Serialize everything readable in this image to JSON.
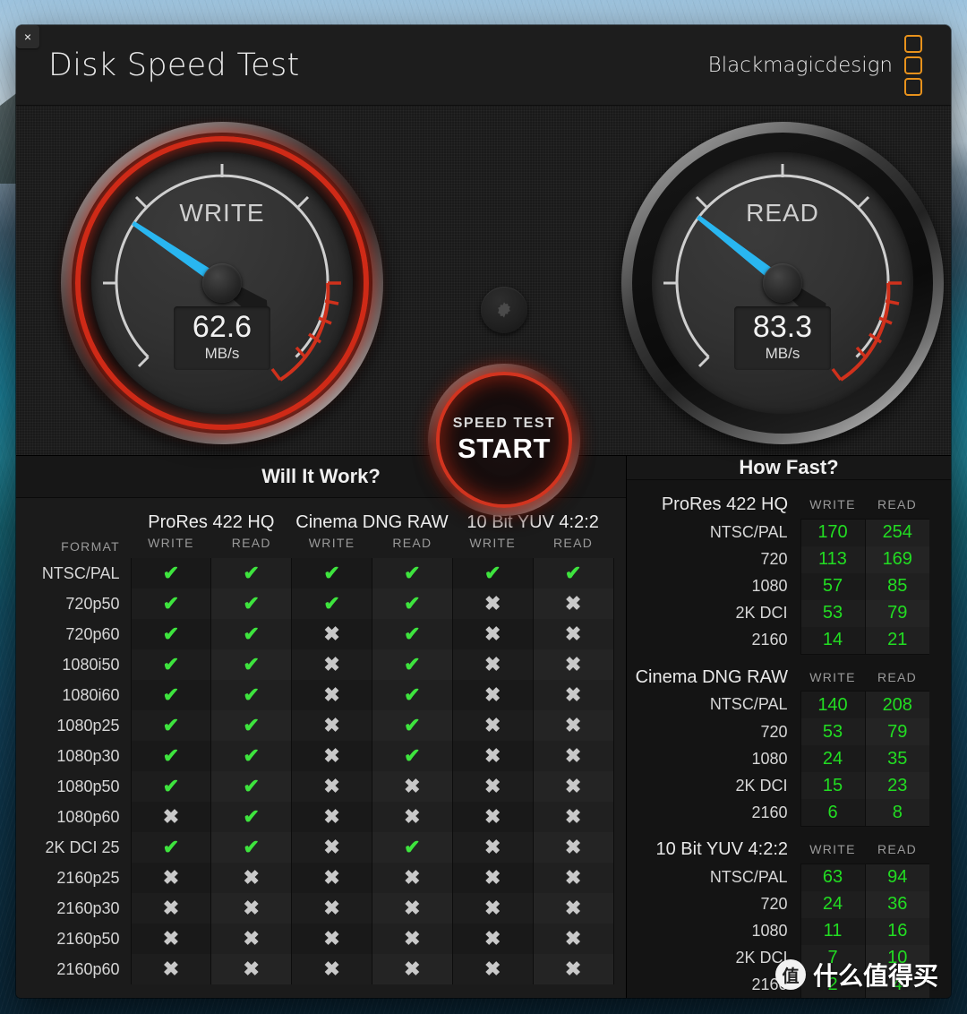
{
  "window": {
    "close_label": "×",
    "title": "Disk Speed Test",
    "brand": "Blackmagicdesign"
  },
  "gauges": {
    "write": {
      "label": "WRITE",
      "value": "62.6",
      "unit": "MB/s",
      "needle_deg": 214
    },
    "read": {
      "label": "READ",
      "value": "83.3",
      "unit": "MB/s",
      "needle_deg": 218
    }
  },
  "controls": {
    "gear_icon": "gear-icon",
    "start_sub": "SPEED TEST",
    "start_main": "START"
  },
  "will_it_work": {
    "title": "Will It Work?",
    "format_label": "FORMAT",
    "groups": [
      "ProRes 422 HQ",
      "Cinema DNG RAW",
      "10 Bit YUV 4:2:2"
    ],
    "sub_columns": [
      "WRITE",
      "READ"
    ],
    "yes_glyph": "✔",
    "no_glyph": "✖",
    "rows": [
      {
        "name": "NTSC/PAL",
        "cells": [
          true,
          true,
          true,
          true,
          true,
          true
        ]
      },
      {
        "name": "720p50",
        "cells": [
          true,
          true,
          true,
          true,
          false,
          false
        ]
      },
      {
        "name": "720p60",
        "cells": [
          true,
          true,
          false,
          true,
          false,
          false
        ]
      },
      {
        "name": "1080i50",
        "cells": [
          true,
          true,
          false,
          true,
          false,
          false
        ]
      },
      {
        "name": "1080i60",
        "cells": [
          true,
          true,
          false,
          true,
          false,
          false
        ]
      },
      {
        "name": "1080p25",
        "cells": [
          true,
          true,
          false,
          true,
          false,
          false
        ]
      },
      {
        "name": "1080p30",
        "cells": [
          true,
          true,
          false,
          true,
          false,
          false
        ]
      },
      {
        "name": "1080p50",
        "cells": [
          true,
          true,
          false,
          false,
          false,
          false
        ]
      },
      {
        "name": "1080p60",
        "cells": [
          false,
          true,
          false,
          false,
          false,
          false
        ]
      },
      {
        "name": "2K DCI 25",
        "cells": [
          true,
          true,
          false,
          true,
          false,
          false
        ]
      },
      {
        "name": "2160p25",
        "cells": [
          false,
          false,
          false,
          false,
          false,
          false
        ]
      },
      {
        "name": "2160p30",
        "cells": [
          false,
          false,
          false,
          false,
          false,
          false
        ]
      },
      {
        "name": "2160p50",
        "cells": [
          false,
          false,
          false,
          false,
          false,
          false
        ]
      },
      {
        "name": "2160p60",
        "cells": [
          false,
          false,
          false,
          false,
          false,
          false
        ]
      }
    ]
  },
  "how_fast": {
    "title": "How Fast?",
    "sub_columns": [
      "WRITE",
      "READ"
    ],
    "blocks": [
      {
        "format": "ProRes 422 HQ",
        "rows": [
          {
            "name": "NTSC/PAL",
            "write": "170",
            "read": "254"
          },
          {
            "name": "720",
            "write": "113",
            "read": "169"
          },
          {
            "name": "1080",
            "write": "57",
            "read": "85"
          },
          {
            "name": "2K DCI",
            "write": "53",
            "read": "79"
          },
          {
            "name": "2160",
            "write": "14",
            "read": "21"
          }
        ]
      },
      {
        "format": "Cinema DNG RAW",
        "rows": [
          {
            "name": "NTSC/PAL",
            "write": "140",
            "read": "208"
          },
          {
            "name": "720",
            "write": "53",
            "read": "79"
          },
          {
            "name": "1080",
            "write": "24",
            "read": "35"
          },
          {
            "name": "2K DCI",
            "write": "15",
            "read": "23"
          },
          {
            "name": "2160",
            "write": "6",
            "read": "8"
          }
        ]
      },
      {
        "format": "10 Bit YUV 4:2:2",
        "rows": [
          {
            "name": "NTSC/PAL",
            "write": "63",
            "read": "94"
          },
          {
            "name": "720",
            "write": "24",
            "read": "36"
          },
          {
            "name": "1080",
            "write": "11",
            "read": "16"
          },
          {
            "name": "2K DCI",
            "write": "7",
            "read": "10"
          },
          {
            "name": "2160",
            "write": "2",
            "read": "4"
          }
        ]
      }
    ]
  },
  "watermark": {
    "badge": "值",
    "text": "什么值得买"
  },
  "colors": {
    "accent_red": "#d2341f",
    "brand_orange": "#e8921c",
    "needle_blue": "#29b6f0",
    "yes_green": "#3ee43e",
    "value_green": "#22dd22"
  }
}
